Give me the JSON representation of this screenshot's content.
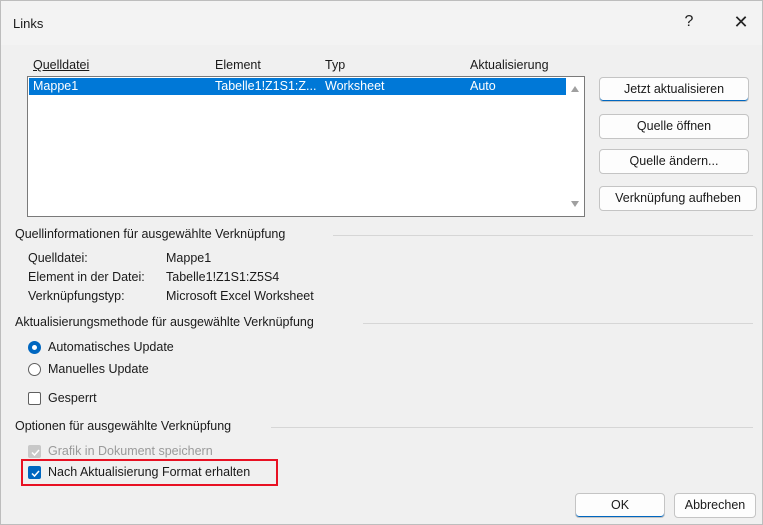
{
  "window": {
    "title": "Links",
    "help_label": "?",
    "close_label": "✕"
  },
  "list": {
    "headers": {
      "source": "Quelldatei",
      "element": "Element",
      "type": "Typ",
      "update": "Aktualisierung"
    },
    "rows": [
      {
        "source": "Mappe1",
        "element": "Tabelle1!Z1S1:Z...",
        "type": "Worksheet",
        "update": "Auto"
      }
    ]
  },
  "buttons": {
    "update_now": "Jetzt aktualisieren",
    "open_source": "Quelle öffnen",
    "change_source": "Quelle ändern...",
    "break_link": "Verknüpfung aufheben",
    "ok": "OK",
    "cancel": "Abbrechen"
  },
  "source_info": {
    "section_title": "Quellinformationen für ausgewählte Verknüpfung",
    "file_label": "Quelldatei:",
    "file_value": "Mappe1",
    "element_label": "Element in der Datei:",
    "element_value": "Tabelle1!Z1S1:Z5S4",
    "type_label": "Verknüpfungstyp:",
    "type_value": "Microsoft Excel Worksheet"
  },
  "update_method": {
    "section_title": "Aktualisierungsmethode für ausgewählte Verknüpfung",
    "auto_label": "Automatisches Update",
    "manual_label": "Manuelles Update",
    "locked_label": "Gesperrt",
    "selected": "auto",
    "locked_checked": false
  },
  "options": {
    "section_title": "Optionen für ausgewählte Verknüpfung",
    "save_graphic_label": "Grafik in Dokument speichern",
    "save_graphic_checked": true,
    "save_graphic_disabled": true,
    "keep_format_label": "Nach Aktualisierung Format erhalten",
    "keep_format_checked": true
  },
  "colors": {
    "accent": "#0067c0",
    "selection": "#0078d7",
    "highlight_border": "#e81123"
  },
  "icons": {
    "help": "question-mark",
    "close": "x-mark",
    "scroll_up": "triangle-up",
    "scroll_down": "triangle-down",
    "check": "checkmark"
  }
}
